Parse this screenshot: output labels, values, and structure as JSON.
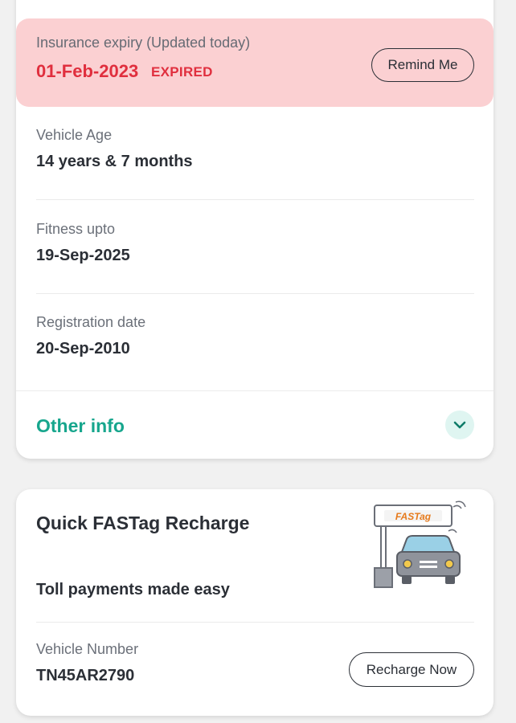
{
  "vehicle_card": {
    "insurance": {
      "label": "Insurance expiry (Updated today)",
      "date": "01-Feb-2023",
      "status": "EXPIRED",
      "remind_button": "Remind Me"
    },
    "vehicle_age": {
      "label": "Vehicle Age",
      "value": "14 years & 7 months"
    },
    "fitness": {
      "label": "Fitness upto",
      "value": "19-Sep-2025"
    },
    "registration": {
      "label": "Registration date",
      "value": "20-Sep-2010"
    },
    "other_info": {
      "label": "Other info",
      "icon": "chevron-down-icon"
    }
  },
  "fastag_card": {
    "title": "Quick FASTag Recharge",
    "subtitle": "Toll payments made easy",
    "illustration_text": "FASTag",
    "vehicle_number_label": "Vehicle Number",
    "vehicle_number": "TN45AR2790",
    "recharge_button": "Recharge Now"
  },
  "colors": {
    "alert_bg": "#fbd0d2",
    "alert_text": "#e02f3e",
    "accent_teal": "#17a68d",
    "text_dark": "#2b2f36"
  }
}
